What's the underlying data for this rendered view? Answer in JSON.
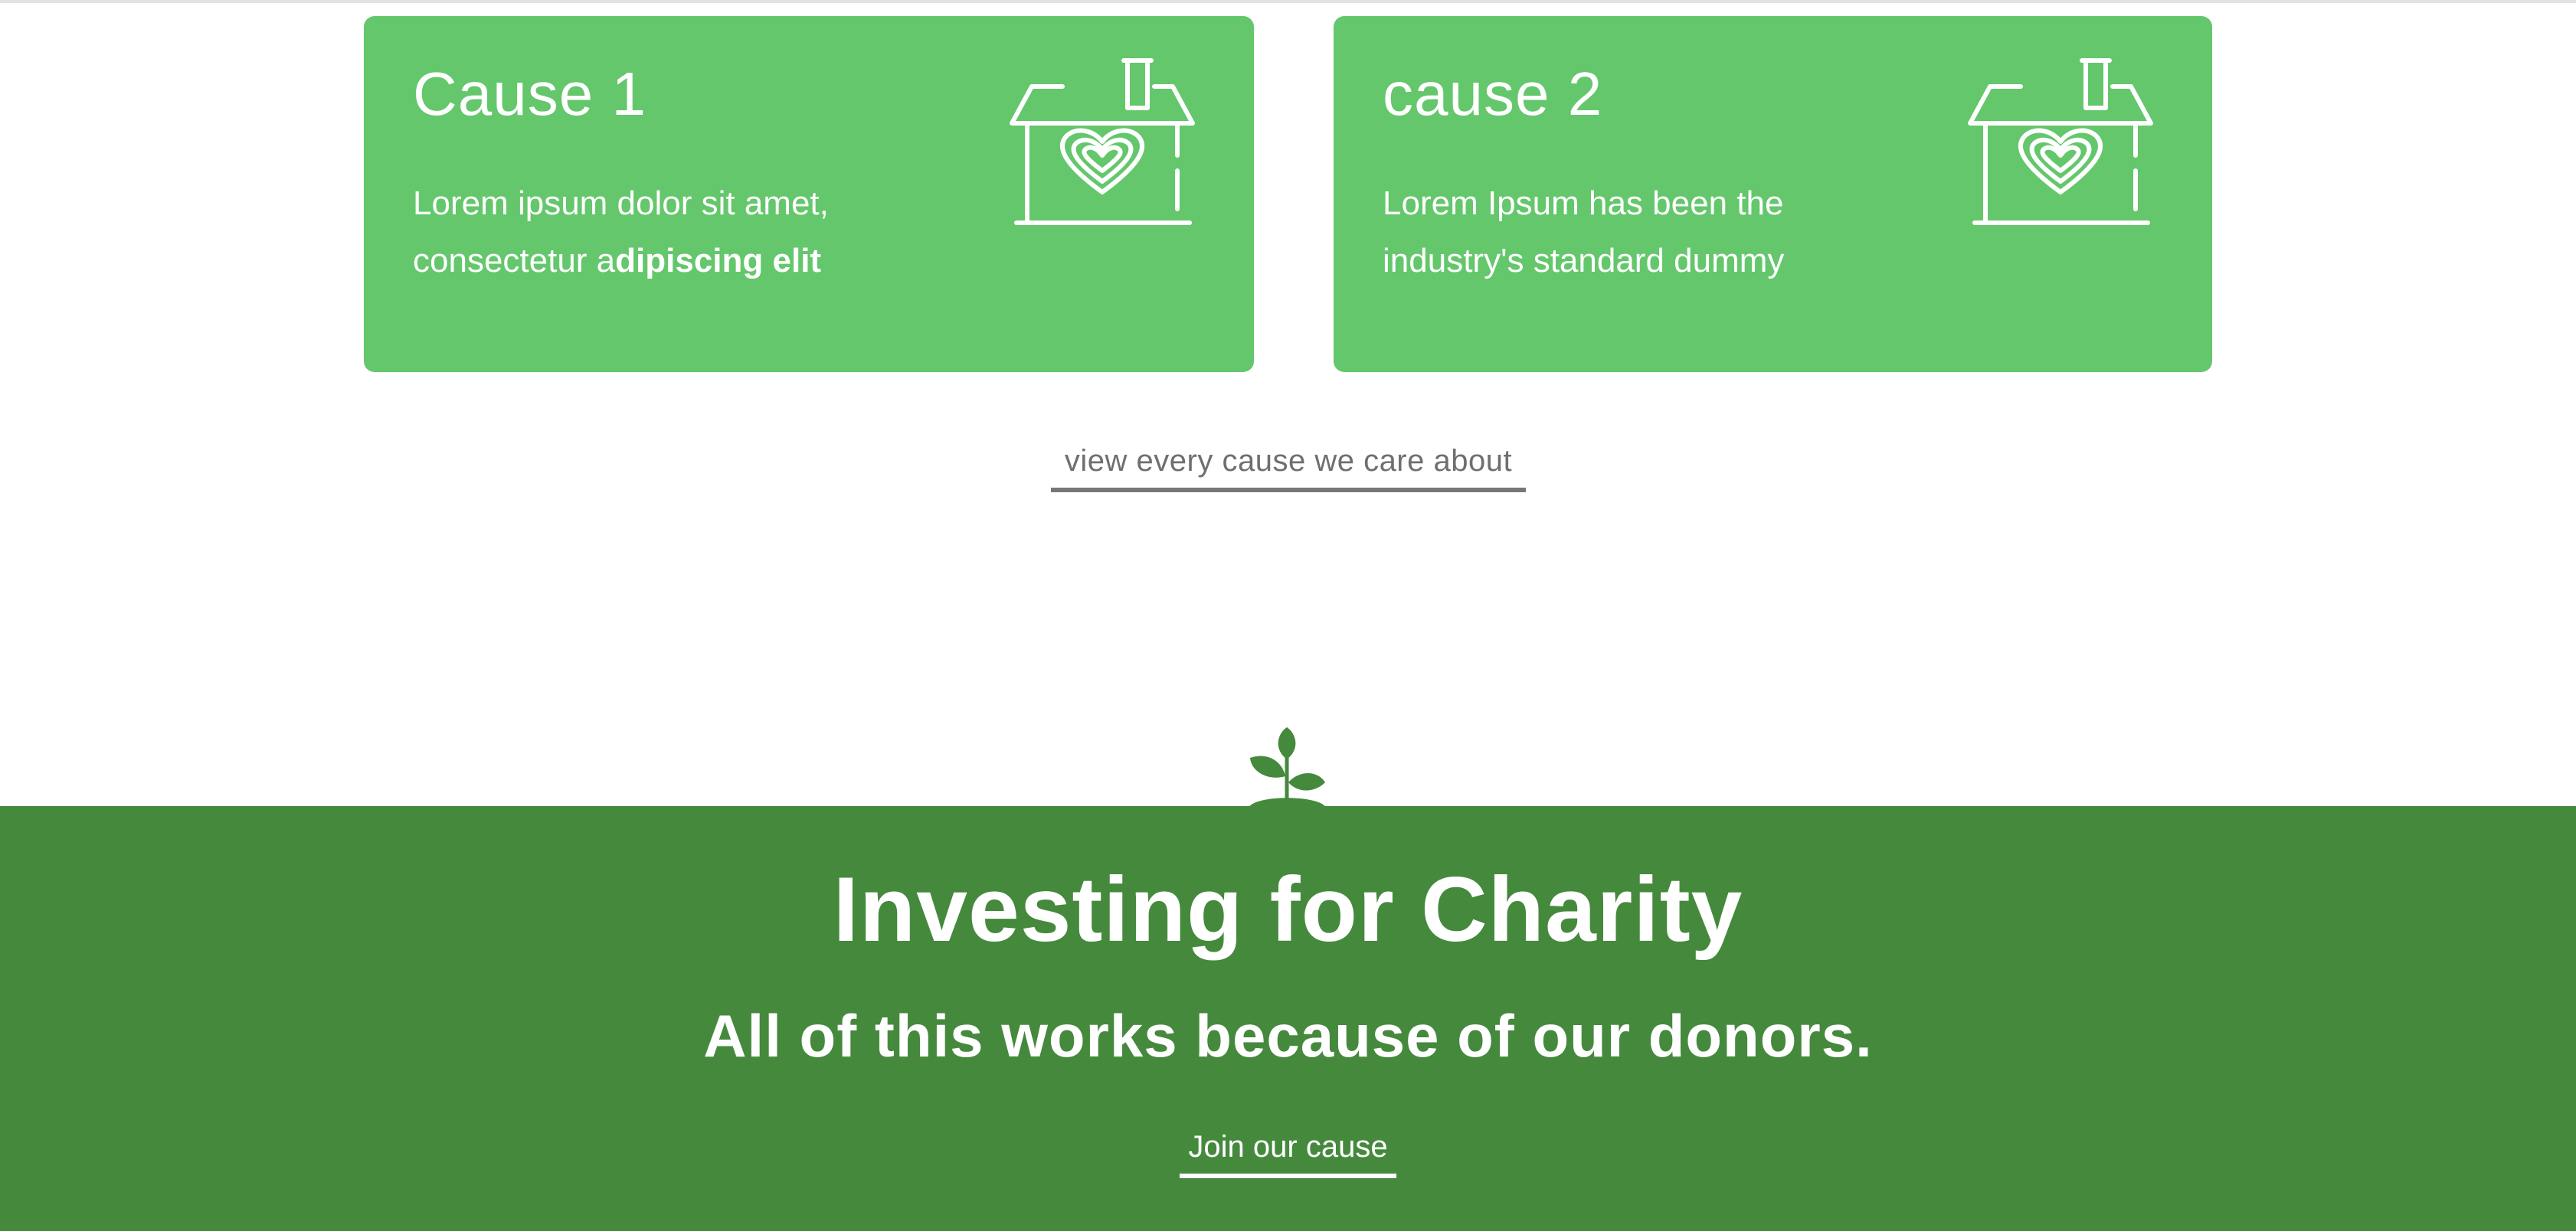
{
  "causes": [
    {
      "title": "Cause 1",
      "text_regular": "Lorem ipsum dolor sit amet, consectetur a",
      "text_bold": "dipiscing elit",
      "icon": "house-heart-icon"
    },
    {
      "title": "cause 2",
      "text_regular": "Lorem Ipsum has been the industry's standard dummy",
      "text_bold": "",
      "icon": "house-heart-icon"
    }
  ],
  "view_all_link": "view every cause we care about",
  "sprout_icon": "sprout-icon",
  "banner": {
    "title": "Investing for Charity",
    "subtitle": "All of this works because of our donors.",
    "cta": "Join our cause"
  },
  "colors": {
    "card_green": "#64c76c",
    "banner_green": "#45893d",
    "link_gray": "#6f6f6f",
    "text_white": "#ffffff"
  }
}
